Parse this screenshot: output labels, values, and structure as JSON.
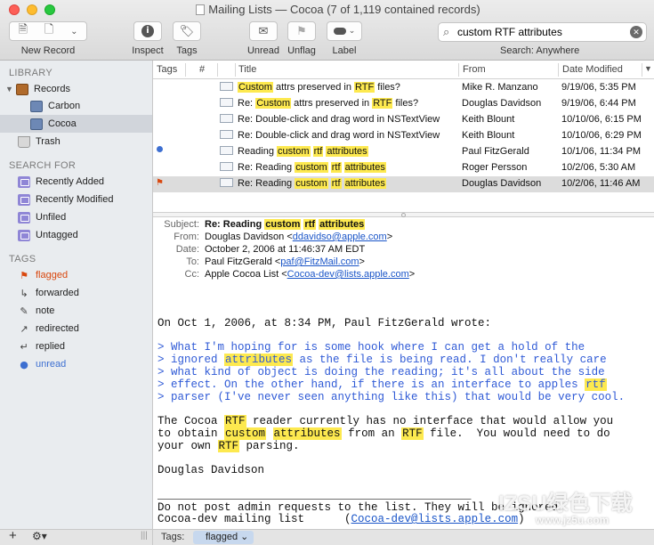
{
  "window": {
    "title": "Mailing Lists — Cocoa (7 of 1,119 contained records)"
  },
  "toolbar": {
    "new_record_label": "New Record",
    "inspect_label": "Inspect",
    "tags_label": "Tags",
    "unread_label": "Unread",
    "unflag_label": "Unflag",
    "label_label": "Label",
    "search_value": "custom RTF attributes",
    "search_scope": "Search: Anywhere"
  },
  "sidebar": {
    "library_header": "LIBRARY",
    "library": [
      {
        "label": "Records"
      },
      {
        "label": "Carbon"
      },
      {
        "label": "Cocoa"
      },
      {
        "label": "Trash"
      }
    ],
    "search_header": "SEARCH FOR",
    "searches": [
      {
        "label": "Recently Added"
      },
      {
        "label": "Recently Modified"
      },
      {
        "label": "Unfiled"
      },
      {
        "label": "Untagged"
      }
    ],
    "tags_header": "TAGS",
    "tags": [
      {
        "label": "flagged",
        "color": "#d9480f"
      },
      {
        "label": "forwarded",
        "color": "#222222"
      },
      {
        "label": "note",
        "color": "#222222"
      },
      {
        "label": "redirected",
        "color": "#222222"
      },
      {
        "label": "replied",
        "color": "#222222"
      },
      {
        "label": "unread",
        "color": "#3d6fd1"
      }
    ]
  },
  "list": {
    "columns": {
      "tags": "Tags",
      "num": "#",
      "title": "Title",
      "from": "From",
      "date": "Date Modified"
    },
    "rows": [
      {
        "from": "Mike R. Manzano",
        "date": "9/19/06, 5:35 PM"
      },
      {
        "from": "Douglas Davidson",
        "date": "9/19/06, 6:44 PM"
      },
      {
        "title": "Re: Double-click and drag word in NSTextView",
        "from": "Keith Blount",
        "date": "10/10/06, 6:15 PM"
      },
      {
        "title": "Re: Double-click and drag word in NSTextView",
        "from": "Keith Blount",
        "date": "10/10/06, 6:29 PM"
      },
      {
        "from": "Paul FitzGerald",
        "date": "10/1/06, 11:34 PM"
      },
      {
        "from": "Roger Persson",
        "date": "10/2/06, 5:30 AM"
      },
      {
        "from": "Douglas Davidson",
        "date": "10/2/06, 11:46 AM"
      }
    ],
    "title_parts": {
      "custom_cap": "Custom",
      "custom": "custom",
      "attrs_preserved_in": " attrs preserved in ",
      "rtf": "RTF",
      "rtf_lower": "rtf",
      "files": " files?",
      "re": "Re: ",
      "reading": "Reading ",
      "re_reading": "Re: Reading ",
      "attributes": "attributes",
      "space": " "
    }
  },
  "message": {
    "headers": {
      "subject_k": "Subject:",
      "subject_v": "Re: Reading custom rtf attributes",
      "from_k": "From:",
      "from_name": "Douglas Davidson <",
      "from_email": "ddavidso@apple.com",
      "from_end": ">",
      "date_k": "Date:",
      "date_v": "October 2, 2006 at 11:46:37 AM EDT",
      "to_k": "To:",
      "to_name": "Paul FitzGerald <",
      "to_email": "paf@FitzMail.com",
      "to_end": ">",
      "cc_k": "Cc:",
      "cc_name": "Apple Cocoa List <",
      "cc_email": "Cocoa-dev@lists.apple.com",
      "cc_end": ">"
    },
    "intro": "On Oct 1, 2006, at 8:34 PM, Paul FitzGerald wrote:",
    "q1": "> What I'm hoping for is some hook where I can get a hold of the",
    "q2a": "> ignored ",
    "q2b": "attributes",
    "q2c": " as the file is being read. I don't really care",
    "q3": "> what kind of object is doing the reading; it's all about the side",
    "q4a": "> effect. On the other hand, if there is an interface to apples ",
    "q4b": "rtf",
    "q5": "> parser (I've never seen anything like this) that would be very cool.",
    "p1a": "The Cocoa ",
    "p1b": "RTF",
    "p1c": " reader currently has no interface that would allow you",
    "p2a": "to obtain ",
    "p2b": "custom",
    "p2c": " ",
    "p2d": "attributes",
    "p2e": " from an ",
    "p2f": "RTF",
    "p2g": " file.  You would need to do",
    "p3a": "your own ",
    "p3b": "RTF",
    "p3c": " parsing.",
    "sig": "Douglas Davidson",
    "rule": "_______________________________________________",
    "f1": "Do not post admin requests to the list. They will be ignored.",
    "f2a": "Cocoa-dev mailing list      (",
    "f2b": "Cocoa-dev@lists.apple.com",
    "f2c": ")"
  },
  "bottom": {
    "tags_label": "Tags:",
    "tag_chip": "flagged ⌄"
  },
  "watermark": {
    "main": "IZSU绿色下载",
    "sub": "www.jz5u.com"
  }
}
